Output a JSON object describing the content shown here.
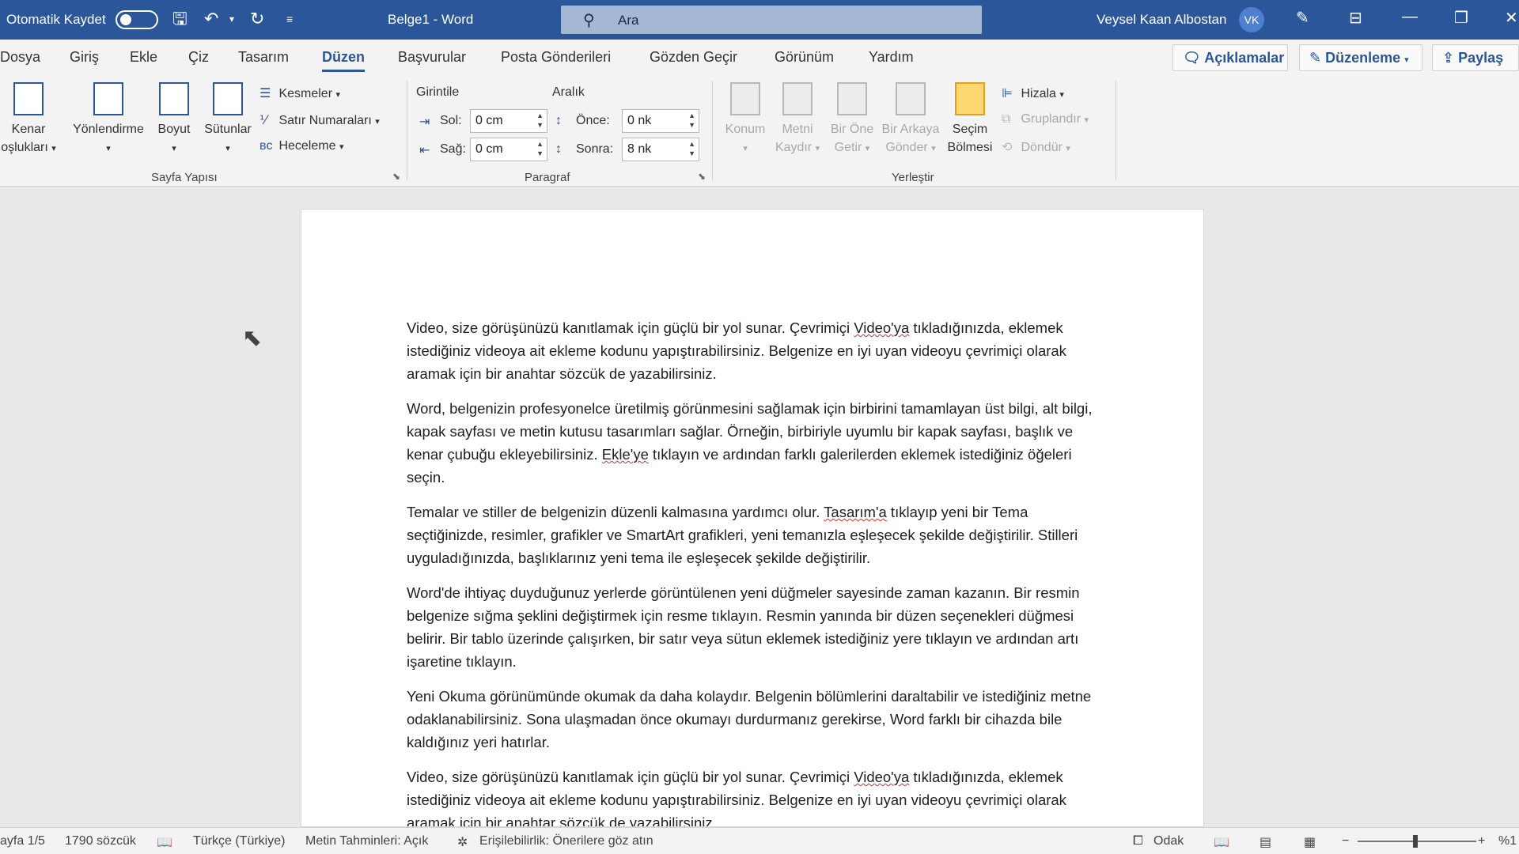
{
  "titlebar": {
    "autosave_label": "Otomatik Kaydet",
    "doc_title": "Belge1  -  Word",
    "search_placeholder": "Ara",
    "user_name": "Veysel Kaan Albostan",
    "user_initials": "VK"
  },
  "tabs": [
    "Dosya",
    "Giriş",
    "Ekle",
    "Çiz",
    "Tasarım",
    "Düzen",
    "Başvurular",
    "Posta Gönderileri",
    "Gözden Geçir",
    "Görünüm",
    "Yardım"
  ],
  "active_tab": "Düzen",
  "tab_buttons": {
    "comments": "Açıklamalar",
    "editing": "Düzenleme",
    "share": "Paylaş"
  },
  "ribbon": {
    "page_setup": {
      "label": "Sayfa Yapısı",
      "margins_l1": "Kenar",
      "margins_l2": "oşlukları",
      "orientation": "Yönlendirme",
      "size": "Boyut",
      "columns": "Sütunlar",
      "breaks": "Kesmeler",
      "line_numbers": "Satır Numaraları",
      "hyphenation": "Heceleme"
    },
    "paragraph": {
      "label": "Paragraf",
      "indent_title": "Girintile",
      "spacing_title": "Aralık",
      "left_label": "Sol:",
      "left_value": "0 cm",
      "right_label": "Sağ:",
      "right_value": "0 cm",
      "before_label": "Önce:",
      "before_value": "0 nk",
      "after_label": "Sonra:",
      "after_value": "8 nk"
    },
    "arrange": {
      "label": "Yerleştir",
      "position_l1": "Konum",
      "wrap_l1": "Metni",
      "wrap_l2": "Kaydır",
      "forward_l1": "Bir Öne",
      "forward_l2": "Getir",
      "backward_l1": "Bir Arkaya",
      "backward_l2": "Gönder",
      "selection_l1": "Seçim",
      "selection_l2": "Bölmesi",
      "align": "Hizala",
      "group": "Gruplandır",
      "rotate": "Döndür"
    }
  },
  "document": {
    "paragraphs": [
      [
        "Video, size görüşünüzü kanıtlamak için güçlü bir yol sunar. Çevrimiçi ",
        "Video'ya",
        " tıkladığınızda, eklemek istediğiniz videoya ait ekleme kodunu yapıştırabilirsiniz. Belgenize en iyi uyan videoyu çevrimiçi olarak aramak için bir anahtar sözcük de yazabilirsiniz."
      ],
      [
        "Word, belgenizin profesyonelce üretilmiş görünmesini sağlamak için birbirini tamamlayan üst bilgi, alt bilgi, kapak sayfası ve metin kutusu tasarımları sağlar. Örneğin, birbiriyle uyumlu bir kapak sayfası, başlık ve kenar çubuğu ekleyebilirsiniz. ",
        "Ekle'ye",
        " tıklayın ve ardından farklı galerilerden eklemek istediğiniz öğeleri seçin."
      ],
      [
        "Temalar ve stiller de belgenizin düzenli kalmasına yardımcı olur. ",
        "Tasarım'a",
        " tıklayıp yeni bir Tema seçtiğinizde, resimler, grafikler ve SmartArt grafikleri, yeni temanızla eşleşecek şekilde değiştirilir. Stilleri uyguladığınızda, başlıklarınız yeni tema ile eşleşecek şekilde değiştirilir."
      ],
      [
        "Word'de ihtiyaç duyduğunuz yerlerde görüntülenen yeni düğmeler sayesinde zaman kazanın. Bir resmin belgenize sığma şeklini değiştirmek için resme tıklayın. Resmin yanında bir düzen seçenekleri düğmesi belirir. Bir tablo üzerinde çalışırken, bir satır veya sütun eklemek istediğiniz yere tıklayın ve ardından artı işaretine tıklayın.",
        "",
        ""
      ],
      [
        "Yeni Okuma görünümünde okumak da daha kolaydır. Belgenin bölümlerini daraltabilir ve istediğiniz metne odaklanabilirsiniz. Sona ulaşmadan önce okumayı durdurmanız gerekirse, Word farklı bir cihazda bile kaldığınız yeri hatırlar.",
        "",
        ""
      ],
      [
        "Video, size görüşünüzü kanıtlamak için güçlü bir yol sunar. Çevrimiçi ",
        "Video'ya",
        " tıkladığınızda, eklemek istediğiniz videoya ait ekleme kodunu yapıştırabilirsiniz. Belgenize en iyi uyan videoyu çevrimiçi olarak aramak için bir anahtar sözcük de yazabilirsiniz."
      ]
    ]
  },
  "statusbar": {
    "page": "ayfa 1/5",
    "words": "1790 sözcük",
    "language": "Türkçe (Türkiye)",
    "predictions": "Metin Tahminleri: Açık",
    "accessibility": "Erişilebilirlik: Önerilere göz atın",
    "focus": "Odak",
    "zoom": "%1"
  },
  "colors": {
    "accent": "#2b579a",
    "search_bg": "#a4b7d3",
    "avatar": "#4e7fd0"
  }
}
